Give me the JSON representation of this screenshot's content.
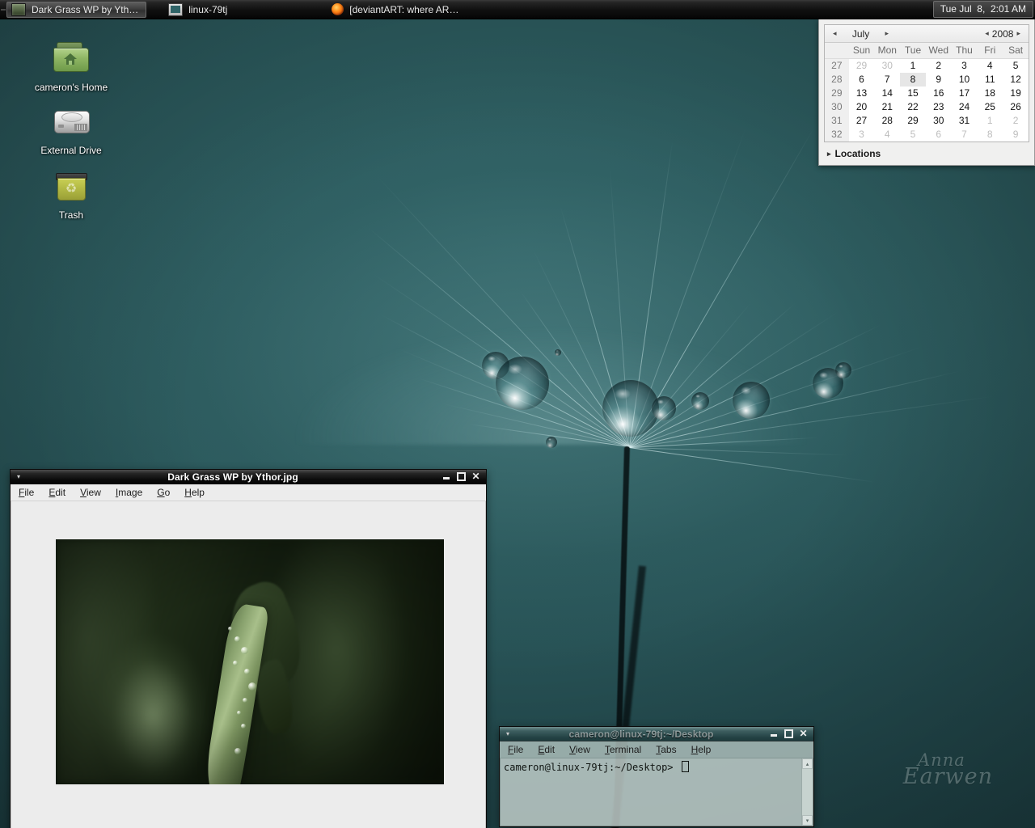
{
  "panel": {
    "tasks": [
      {
        "label": "Dark Grass WP by Yth…",
        "icon": "image-file-icon",
        "active": true
      },
      {
        "label": "linux-79tj",
        "icon": "terminal-icon",
        "active": false
      },
      {
        "label": "[deviantART: where AR…",
        "icon": "firefox-icon",
        "active": false
      }
    ],
    "clock": "Tue Jul  8,  2:01 AM"
  },
  "desktop": {
    "icons": [
      {
        "label": "cameron's Home",
        "icon": "home-folder-icon"
      },
      {
        "label": "External Drive",
        "icon": "hard-drive-icon"
      },
      {
        "label": "Trash",
        "icon": "trash-icon"
      }
    ],
    "watermark_line1": "Anna",
    "watermark_line2": "Earwen"
  },
  "calendar": {
    "month": "July",
    "year": "2008",
    "prev_month_arrow": "◂",
    "next_month_arrow": "▸",
    "prev_year_arrow": "◂",
    "next_year_arrow": "▸",
    "weekday_headers": [
      "Sun",
      "Mon",
      "Tue",
      "Wed",
      "Thu",
      "Fri",
      "Sat"
    ],
    "week_numbers": [
      "27",
      "28",
      "29",
      "30",
      "31",
      "32"
    ],
    "weeks": [
      [
        {
          "d": "29",
          "o": true
        },
        {
          "d": "30",
          "o": true
        },
        {
          "d": "1"
        },
        {
          "d": "2"
        },
        {
          "d": "3"
        },
        {
          "d": "4"
        },
        {
          "d": "5"
        }
      ],
      [
        {
          "d": "6"
        },
        {
          "d": "7"
        },
        {
          "d": "8",
          "today": true
        },
        {
          "d": "9"
        },
        {
          "d": "10"
        },
        {
          "d": "11"
        },
        {
          "d": "12"
        }
      ],
      [
        {
          "d": "13"
        },
        {
          "d": "14"
        },
        {
          "d": "15"
        },
        {
          "d": "16"
        },
        {
          "d": "17"
        },
        {
          "d": "18"
        },
        {
          "d": "19"
        }
      ],
      [
        {
          "d": "20"
        },
        {
          "d": "21"
        },
        {
          "d": "22"
        },
        {
          "d": "23"
        },
        {
          "d": "24"
        },
        {
          "d": "25"
        },
        {
          "d": "26"
        }
      ],
      [
        {
          "d": "27"
        },
        {
          "d": "28"
        },
        {
          "d": "29"
        },
        {
          "d": "30"
        },
        {
          "d": "31"
        },
        {
          "d": "1",
          "o": true
        },
        {
          "d": "2",
          "o": true
        }
      ],
      [
        {
          "d": "3",
          "o": true
        },
        {
          "d": "4",
          "o": true
        },
        {
          "d": "5",
          "o": true
        },
        {
          "d": "6",
          "o": true
        },
        {
          "d": "7",
          "o": true
        },
        {
          "d": "8",
          "o": true
        },
        {
          "d": "9",
          "o": true
        }
      ]
    ],
    "locations_label": "Locations",
    "locations_triangle": "▸"
  },
  "viewer": {
    "title": "Dark Grass WP by Ythor.jpg",
    "titlebar_menu_arrow": "▾",
    "minimize": "minimize-icon",
    "maximize": "maximize-icon",
    "close": "✕",
    "menus": [
      "File",
      "Edit",
      "View",
      "Image",
      "Go",
      "Help"
    ]
  },
  "terminal": {
    "title": "cameron@linux-79tj:~/Desktop",
    "titlebar_menu_arrow": "▾",
    "close": "✕",
    "menus": [
      "File",
      "Edit",
      "View",
      "Terminal",
      "Tabs",
      "Help"
    ],
    "prompt": "cameron@linux-79tj:~/Desktop> ",
    "scroll_up": "▴",
    "scroll_down": "▾"
  },
  "colors": {
    "desktop_teal": "#2b595c",
    "panel_black": "#111111",
    "window_gray": "#ececec",
    "terminal_glass": "#c6d2ce"
  }
}
